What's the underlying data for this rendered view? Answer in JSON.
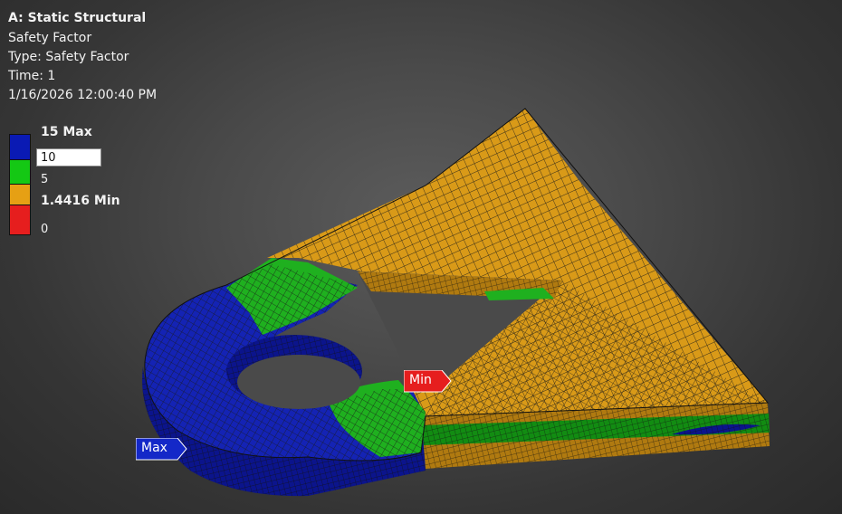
{
  "header": {
    "title": "A: Static Structural",
    "result": "Safety Factor",
    "type": "Type: Safety Factor",
    "time": "Time: 1",
    "timestamp": "1/16/2026 12:00:40 PM"
  },
  "legend": {
    "max_label": "15 Max",
    "edit_value": "10",
    "mid_label": "5",
    "min_label": "1.4416 Min",
    "zero_label": "0",
    "colors": {
      "blue": "#0a1ab4",
      "green": "#14c814",
      "orange": "#e6a014",
      "red": "#e61e1e"
    }
  },
  "probes": {
    "min": {
      "label": "Min",
      "color": "#e61e1e"
    },
    "max": {
      "label": "Max",
      "color": "#1428c8"
    }
  },
  "model": {
    "colors": {
      "top_orange": "#d99a18",
      "top_blue": "#1423b4",
      "top_green": "#1fb01f",
      "side_dark_blue": "#0b148c",
      "side_orange": "#b07a10",
      "side_green": "#128c12",
      "mesh_line": "#1a1a1a"
    }
  }
}
